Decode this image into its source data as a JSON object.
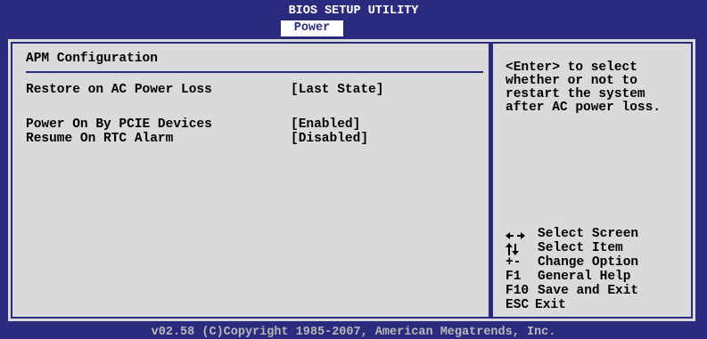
{
  "header": {
    "title": "BIOS SETUP UTILITY",
    "active_tab": "Power"
  },
  "colors": {
    "background": "#2a2a7e",
    "panel": "#dadada",
    "text": "#000000",
    "header_text": "#ffffff"
  },
  "left_panel": {
    "section_title": "APM Configuration",
    "settings": [
      {
        "label": "Restore on AC Power Loss",
        "value": "[Last State]"
      },
      {
        "label": "Power On By PCIE Devices",
        "value": "[Enabled]"
      },
      {
        "label": "Resume On RTC Alarm",
        "value": "[Disabled]"
      }
    ]
  },
  "right_panel": {
    "help_lines": [
      "<Enter> to select",
      "whether or not to",
      "restart the system",
      "after AC power loss."
    ],
    "keys": [
      {
        "key_icon": "left-right-arrows-icon",
        "key": "",
        "desc": "Select Screen"
      },
      {
        "key_icon": "up-down-arrows-icon",
        "key": "",
        "desc": "Select Item"
      },
      {
        "key": "+-",
        "desc": "Change Option"
      },
      {
        "key": "F1",
        "desc": "General Help"
      },
      {
        "key": "F10",
        "desc": "Save and Exit"
      },
      {
        "key": "ESC",
        "desc": "Exit"
      }
    ]
  },
  "footer": {
    "copyright": "v02.58 (C)Copyright 1985-2007, American Megatrends, Inc."
  }
}
